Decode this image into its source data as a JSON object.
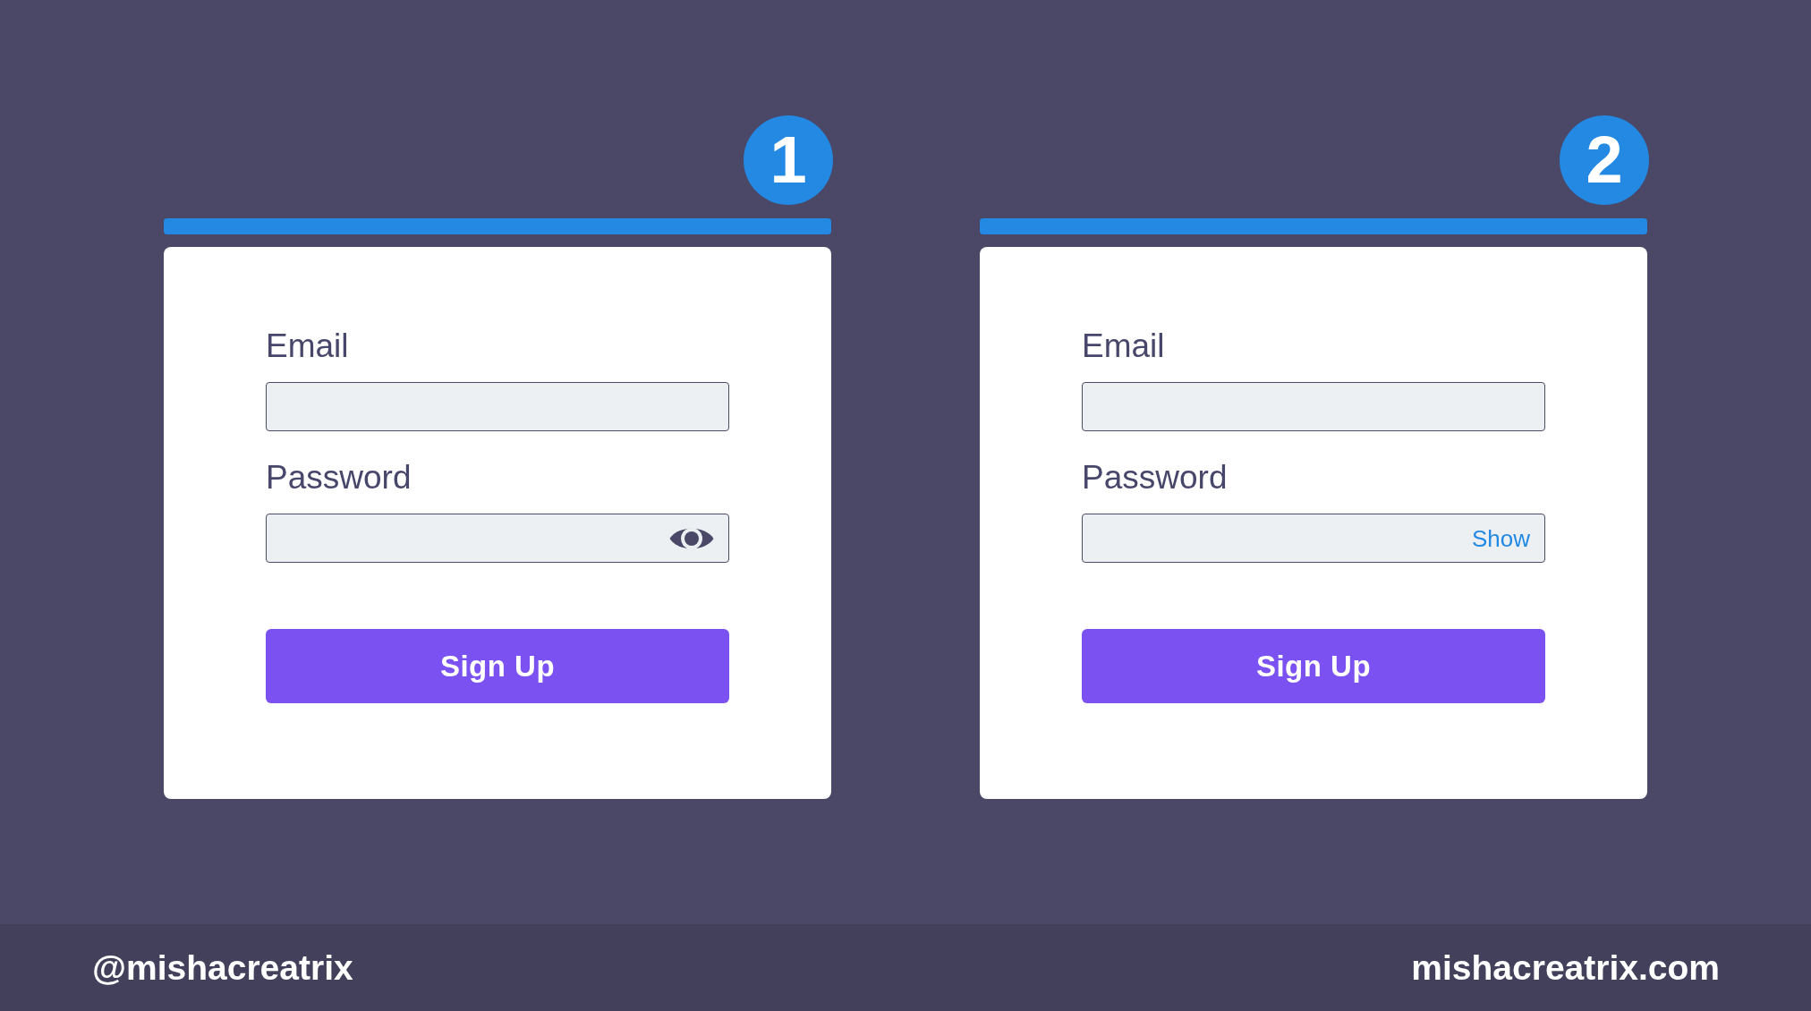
{
  "variants": [
    {
      "number": "1",
      "form": {
        "fields": [
          {
            "label": "Email"
          },
          {
            "label": "Password",
            "toggle": {
              "kind": "icon"
            }
          }
        ],
        "submit": "Sign Up"
      }
    },
    {
      "number": "2",
      "form": {
        "fields": [
          {
            "label": "Email"
          },
          {
            "label": "Password",
            "toggle": {
              "kind": "text",
              "label": "Show"
            }
          }
        ],
        "submit": "Sign Up"
      }
    }
  ],
  "footer": {
    "handle": "@mishacreatrix",
    "website": "mishacreatrix.com"
  }
}
